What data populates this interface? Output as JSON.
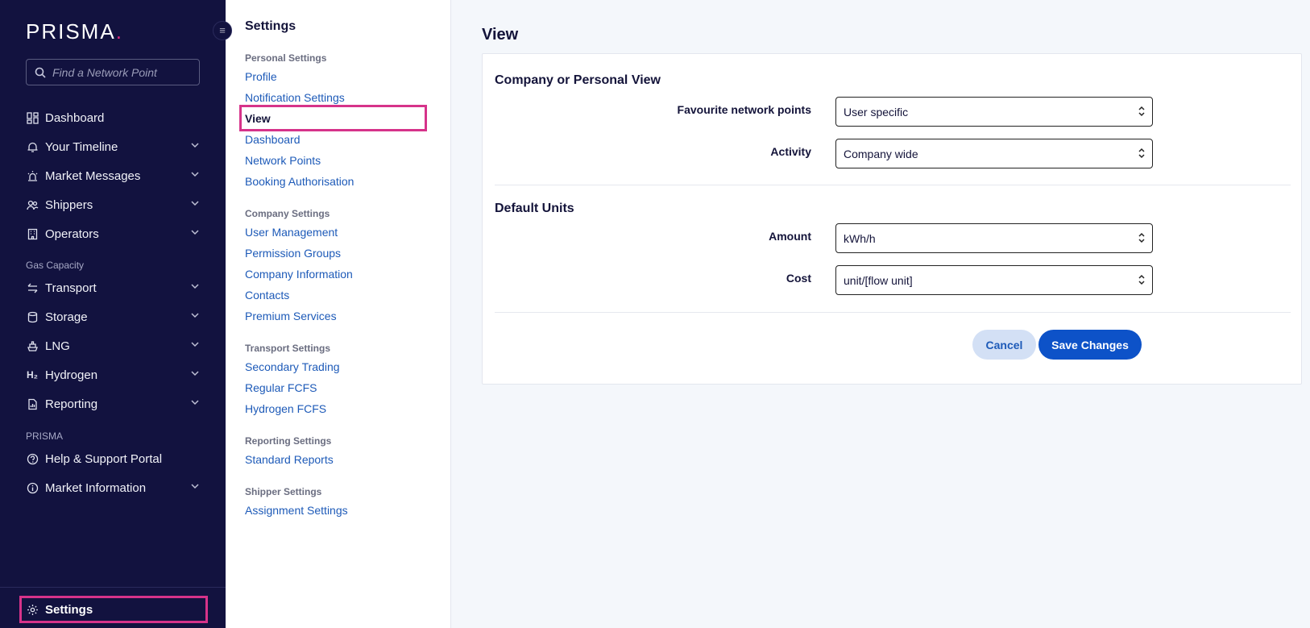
{
  "brand": {
    "name": "PRISMA",
    "dot": ".",
    "accent": "#e0267d"
  },
  "sidebar": {
    "search_placeholder": "Find a Network Point",
    "items": [
      {
        "label": "Dashboard",
        "icon": "dashboard-icon"
      },
      {
        "label": "Your Timeline",
        "icon": "bell-icon"
      },
      {
        "label": "Market Messages",
        "icon": "alarm-icon"
      },
      {
        "label": "Shippers",
        "icon": "users-icon"
      },
      {
        "label": "Operators",
        "icon": "building-icon"
      }
    ],
    "section_gas": "Gas Capacity",
    "gas_items": [
      {
        "label": "Transport",
        "icon": "transfer-icon"
      },
      {
        "label": "Storage",
        "icon": "database-icon"
      },
      {
        "label": "LNG",
        "icon": "ship-icon"
      },
      {
        "label": "Hydrogen",
        "icon": "h2-icon",
        "icon_text": "H₂"
      },
      {
        "label": "Reporting",
        "icon": "report-icon"
      }
    ],
    "section_prisma": "PRISMA",
    "prisma_items": [
      {
        "label": "Help & Support Portal",
        "icon": "help-icon"
      },
      {
        "label": "Market Information",
        "icon": "info-icon"
      }
    ],
    "settings_label": "Settings"
  },
  "submenu": {
    "title": "Settings",
    "personal": {
      "label": "Personal Settings",
      "links": [
        "Profile",
        "Notification Settings",
        "View",
        "Dashboard",
        "Network Points",
        "Booking Authorisation"
      ]
    },
    "company": {
      "label": "Company Settings",
      "links": [
        "User Management",
        "Permission Groups",
        "Company Information",
        "Contacts",
        "Premium Services"
      ]
    },
    "transport": {
      "label": "Transport Settings",
      "links": [
        "Secondary Trading",
        "Regular FCFS",
        "Hydrogen FCFS"
      ]
    },
    "reporting": {
      "label": "Reporting Settings",
      "links": [
        "Standard Reports"
      ]
    },
    "shipper": {
      "label": "Shipper Settings",
      "links": [
        "Assignment Settings"
      ]
    }
  },
  "main": {
    "title": "View",
    "section1": {
      "title": "Company or Personal View",
      "favourite_label": "Favourite network points",
      "favourite_value": "User specific",
      "activity_label": "Activity",
      "activity_value": "Company wide"
    },
    "section2": {
      "title": "Default Units",
      "amount_label": "Amount",
      "amount_value": "kWh/h",
      "cost_label": "Cost",
      "cost_value": "unit/[flow unit]"
    },
    "cancel_label": "Cancel",
    "save_label": "Save Changes"
  }
}
